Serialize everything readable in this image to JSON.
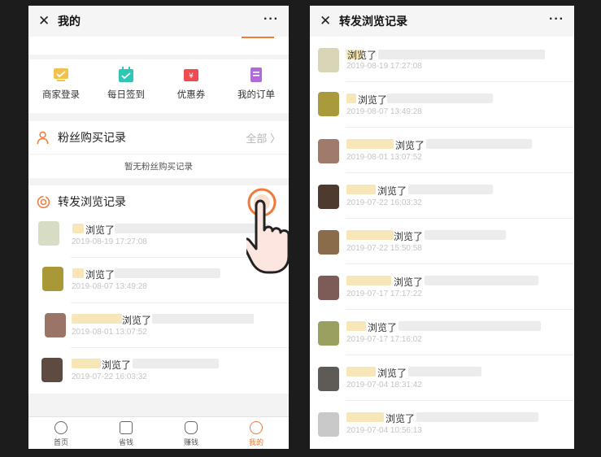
{
  "left": {
    "title": "我的",
    "close_icon": "close-icon",
    "more_icon": "more-icon",
    "quick_items": [
      {
        "label": "商家登录",
        "icon": "merchant-icon",
        "color": "#f2c14e"
      },
      {
        "label": "每日签到",
        "icon": "calendar-check-icon",
        "color": "#2fc6b8"
      },
      {
        "label": "优惠券",
        "icon": "coupon-icon",
        "color": "#ef4b53"
      },
      {
        "label": "我的订单",
        "icon": "order-icon",
        "color": "#b26ad9"
      }
    ],
    "fans_section": {
      "title": "粉丝购买记录",
      "more": "全部",
      "empty": "暂无粉丝购买记录"
    },
    "forward_section": {
      "title": "转发浏览记录",
      "records": [
        {
          "label": "浏览了",
          "date": "2019-08-19 17:27:08"
        },
        {
          "label": "浏览了",
          "date": "2019-08-07 13:49:28"
        },
        {
          "label": "浏览了",
          "date": "2019-08-01 13:07:52"
        },
        {
          "label": "浏览了",
          "date": "2019-07-22 16:03:32"
        }
      ]
    },
    "tabs": [
      {
        "label": "首页",
        "icon": "compass-icon",
        "active": false
      },
      {
        "label": "省钱",
        "icon": "save-icon",
        "active": false
      },
      {
        "label": "赚钱",
        "icon": "money-bag-icon",
        "active": false
      },
      {
        "label": "我的",
        "icon": "person-icon",
        "active": true
      }
    ]
  },
  "right": {
    "title": "转发浏览记录",
    "records": [
      {
        "label": "浏览了",
        "date": "2019-08-19 17:27:08"
      },
      {
        "label": "浏览了",
        "date": "2019-08-07 13:49:28"
      },
      {
        "label": "浏览了",
        "date": "2019-08-01 13:07:52"
      },
      {
        "label": "浏览了",
        "date": "2019-07-22 16:03:32"
      },
      {
        "label": "浏览了",
        "date": "2019-07-22 15:50:58"
      },
      {
        "label": "浏览了",
        "date": "2019-07-17 17:17:22"
      },
      {
        "label": "浏览了",
        "date": "2019-07-17 17:16:02"
      },
      {
        "label": "浏览了",
        "date": "2019-07-04 18:31:42"
      },
      {
        "label": "浏览了",
        "date": "2019-07-04 10:56:13"
      }
    ]
  },
  "colors": {
    "accent": "#f07a3a",
    "background": "#1c1c1c"
  }
}
